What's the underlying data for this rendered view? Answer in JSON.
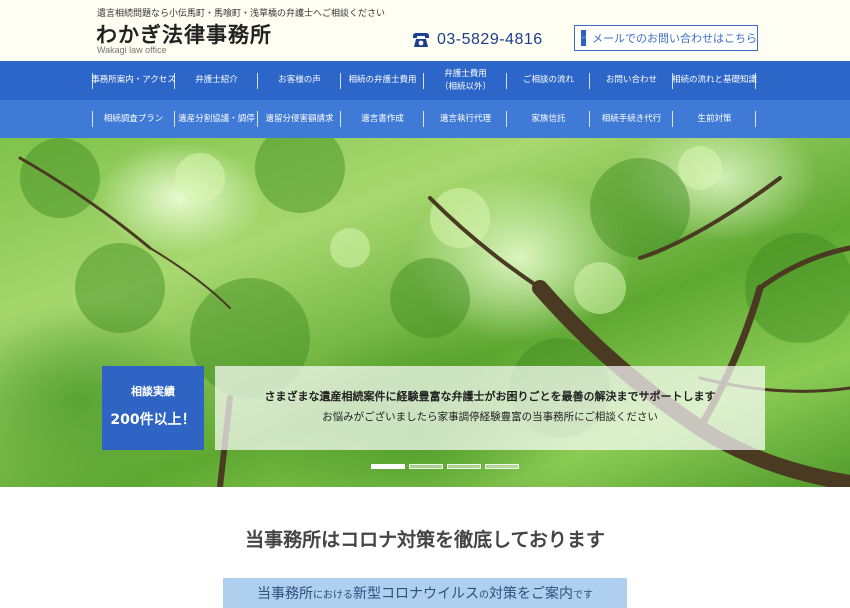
{
  "header": {
    "tagline": "遺言相続問題なら小伝馬町・馬喰町・浅草橋の弁護士へご相談ください",
    "logo_title": "わかぎ法律事務所",
    "logo_subtitle": "Wakagi law office",
    "phone_icon": "telephone-icon",
    "phone_number": "03-5829-4816",
    "mail_icon": "envelope-icon",
    "mail_label": "メールでのお問い合わせはこちら"
  },
  "nav_primary": [
    "事務所案内・アクセス",
    "弁護士紹介",
    "お客様の声",
    "相続の弁護士費用",
    "弁護士費用\n（相続以外）",
    "ご相談の流れ",
    "お問い合わせ",
    "相続の流れと基礎知識"
  ],
  "nav_secondary": [
    "相続調査プラン",
    "遺産分割協議・調停",
    "遺留分侵害額請求",
    "遺言書作成",
    "遺言執行代理",
    "家族信託",
    "相続手続き代行",
    "生前対策"
  ],
  "hero": {
    "badge_label": "相談実績",
    "badge_value": "200件以上！",
    "line1": "さまざまな遺産相続案件に経験豊富な弁護士がお困りごとを最善の解決までサポートします",
    "line2": "お悩みがございましたら家事調停経験豊富の当事務所にご相談ください",
    "slide_count": 4,
    "active_slide": 1
  },
  "content": {
    "section_title": "当事務所はコロナ対策を徹底しております",
    "notice_part1": "当事務所",
    "notice_part2": "における",
    "notice_part3": "新型コロナウイルス",
    "notice_part4": "の",
    "notice_part5": "対策をご案内",
    "notice_part6": "です"
  },
  "colors": {
    "nav_primary_bg": "#2c66c9",
    "nav_secondary_bg": "#3f7bd6",
    "badge_bg": "#2f64c4",
    "notice_bg": "#aecfee",
    "header_bg": "#fffef2"
  }
}
